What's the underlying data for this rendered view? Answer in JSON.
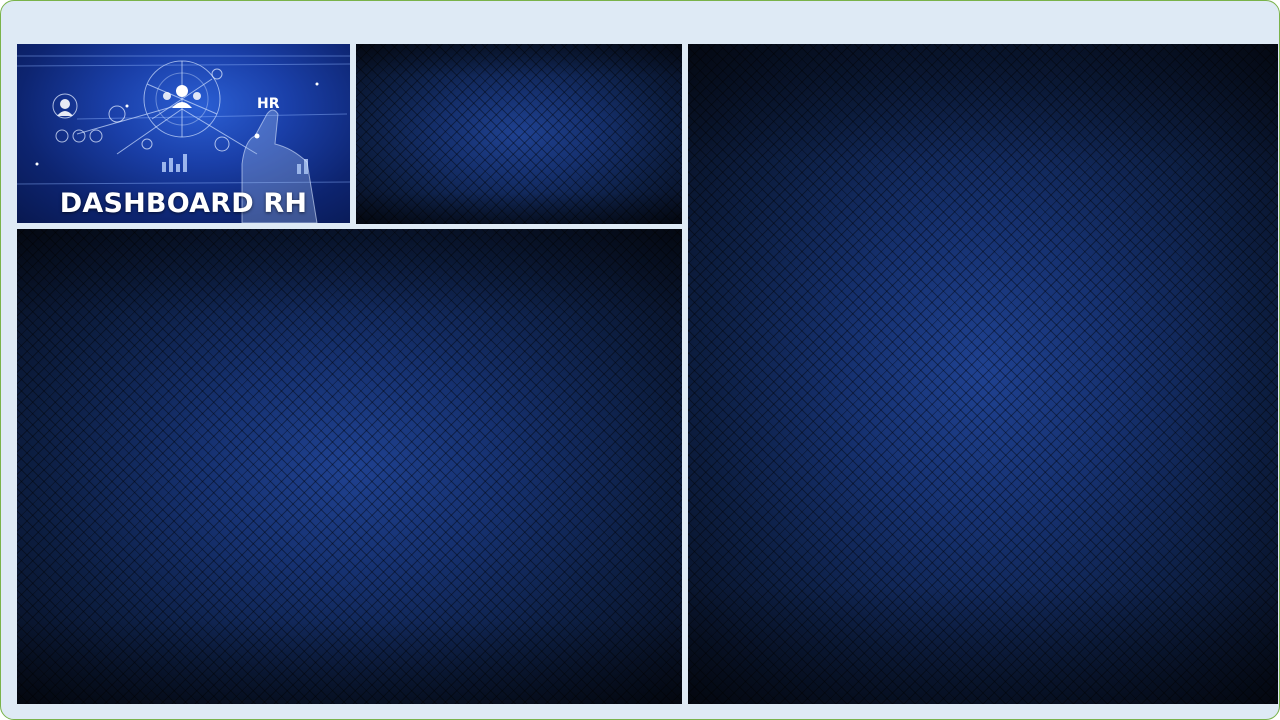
{
  "header": {
    "title": "DASHBOARD RH",
    "badge": "HR"
  },
  "colors": {
    "frame_background": "#deeaf5",
    "frame_border": "#79b34a",
    "panel_dark": "#0a1730",
    "panel_glow": "#1f4190",
    "hero_blue": "#1a3fa8"
  },
  "panels": [
    {
      "id": "top-middle",
      "content": ""
    },
    {
      "id": "bottom-left",
      "content": ""
    },
    {
      "id": "right",
      "content": ""
    }
  ]
}
